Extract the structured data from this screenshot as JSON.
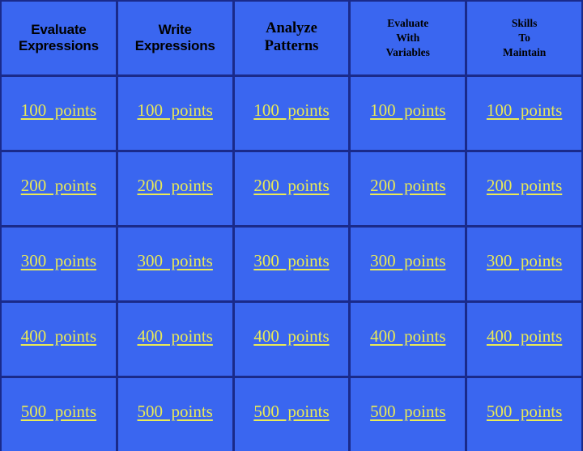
{
  "board": {
    "background_color": "#3a66f0",
    "grid_line_color": "#1a2a8a",
    "header_text_color": "#000000",
    "point_text_color": "#eaea55",
    "categories": [
      {
        "label": "Evaluate\nExpressions",
        "style": "sans"
      },
      {
        "label": "Write\nExpressions",
        "style": "sans"
      },
      {
        "label": "Analyze\nPatterns",
        "style": "serif-lg"
      },
      {
        "label": "Evaluate\nWith\nVariables",
        "style": "serif-sm"
      },
      {
        "label": "Skills\nTo\nMaintain",
        "style": "serif-sm"
      }
    ],
    "rows": [
      {
        "value": "100",
        "cells": [
          "100  points",
          "100  points",
          "100  points",
          "100  points",
          "100  points"
        ]
      },
      {
        "value": "200",
        "cells": [
          "200  points",
          "200  points",
          "200  points",
          "200  points",
          "200  points"
        ]
      },
      {
        "value": "300",
        "cells": [
          "300  points",
          "300  points",
          "300  points",
          "300  points",
          "300  points"
        ]
      },
      {
        "value": "400",
        "cells": [
          "400  points",
          "400  points",
          "400  points",
          "400  points",
          "400  points"
        ]
      },
      {
        "value": "500",
        "cells": [
          "500  points",
          "500  points",
          "500  points",
          "500  points",
          "500  points"
        ]
      }
    ]
  }
}
